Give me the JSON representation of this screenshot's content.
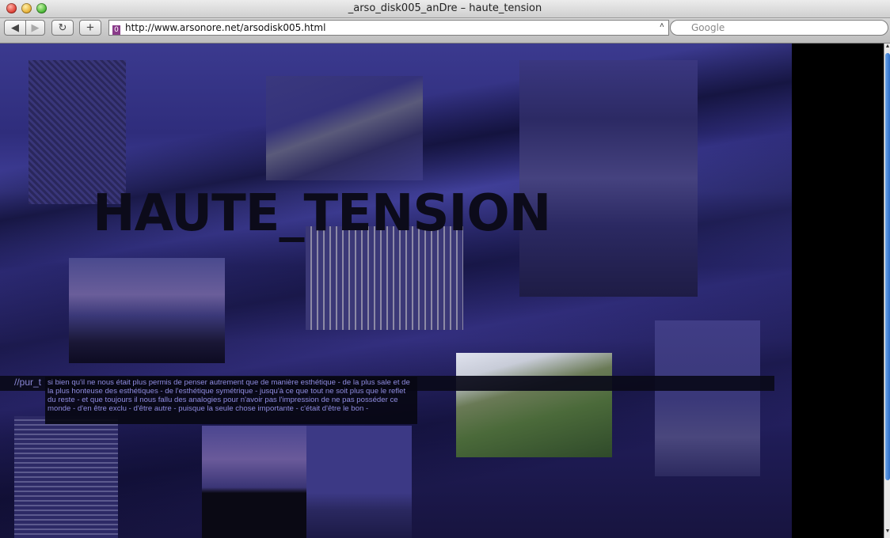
{
  "window": {
    "title": "_arso_disk005_anDre – haute_tension"
  },
  "toolbar": {
    "back_icon": "◀",
    "forward_icon": "▶",
    "reload_icon": "↻",
    "add_icon": "+",
    "favicon_text": "0",
    "url": "http://www.arsonore.net/arsodisk005.html",
    "url_chevron": "˄",
    "search_placeholder": "Google",
    "search_icon": "🔍︎"
  },
  "page": {
    "headline": "HAUTE_TENSION",
    "band_label": "//pur_t",
    "body_text": "si bien qu'il ne nous était plus permis de penser autrement que de manière esthétique - de la plus sale et de la plus honteuse des esthétiques - de l'esthétique symétrique - jusqu'à ce que tout ne soit plus que le reflet du reste - et que toujours il nous fallu des analogies pour n'avoir pas l'impression de ne pas posséder ce monde - d'en être exclu - d'être autre - puisque la seule chose importante - c'était d'être le bon -"
  },
  "colors": {
    "background_blue": "#2f2d7c",
    "text_blue": "#8f8ce0",
    "headline": "#0c0b1a"
  }
}
